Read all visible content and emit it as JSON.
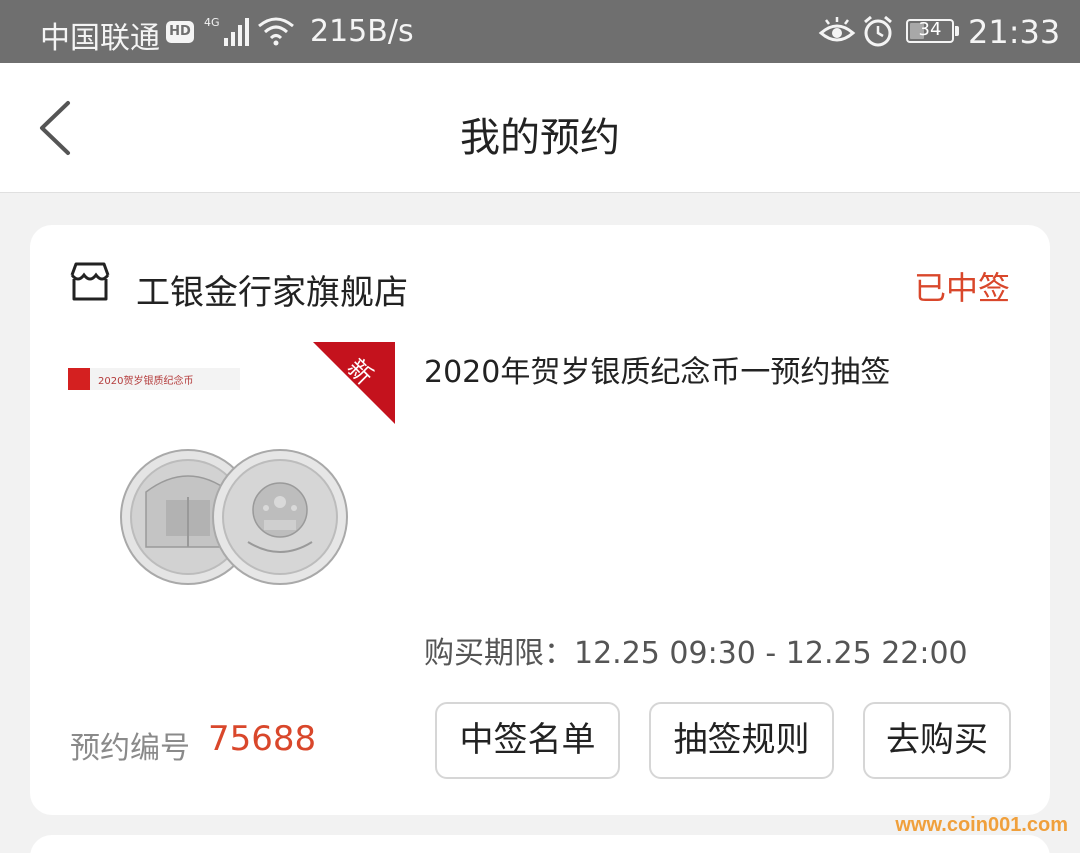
{
  "status_bar": {
    "carrier": "中国联通",
    "hd_badge": "HD",
    "network_type": "4G",
    "net_speed": "215B/s",
    "battery_level": "34",
    "battery_fraction": 0.34,
    "time": "21:33"
  },
  "nav": {
    "title": "我的预约",
    "back_icon": "chevron-left-icon"
  },
  "order": {
    "store_icon": "store-icon",
    "store_name": "工银金行家旗舰店",
    "status": "已中签",
    "product": {
      "title": "2020年贺岁银质纪念币一预约抽签",
      "image_banner": "2020贺岁银质纪念币",
      "image_corner_tag": "新"
    },
    "purchase_period_label": "购买期限：",
    "purchase_period_value": "12.25 09:30 - 12.25 22:00",
    "reservation_label": "预约编号",
    "reservation_number": "75688",
    "buttons": {
      "winners_list": "中签名单",
      "lottery_rules": "抽签规则",
      "buy": "去购买"
    }
  },
  "colors": {
    "accent": "#d9472b",
    "status_bar_bg": "#6f6f6f",
    "page_bg": "#f2f2f2"
  },
  "watermark": "www.coin001.com"
}
